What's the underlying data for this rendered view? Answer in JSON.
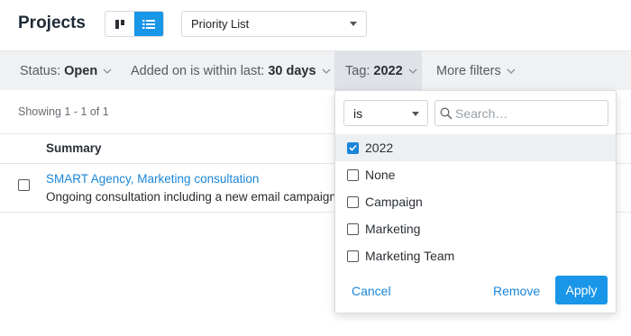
{
  "header": {
    "title": "Projects",
    "view_toggle": {
      "board_icon": "board-view-icon",
      "list_icon": "list-view-icon",
      "active": "list"
    },
    "list_select": {
      "value": "Priority List"
    }
  },
  "filters": [
    {
      "label": "Status:",
      "value": "Open"
    },
    {
      "label": "Added on is within last:",
      "value": "30 days"
    },
    {
      "label": "Tag:",
      "value": "2022"
    },
    {
      "label": "More filters",
      "value": ""
    }
  ],
  "results": {
    "showing": "Showing 1 - 1 of 1"
  },
  "table": {
    "columns": [
      "Summary"
    ],
    "rows": [
      {
        "title": "SMART Agency, Marketing consultation",
        "description": "Ongoing consultation including a new email campaign la"
      }
    ]
  },
  "tag_dropdown": {
    "operator": "is",
    "search_placeholder": "Search…",
    "options": [
      {
        "label": "2022",
        "checked": true
      },
      {
        "label": "None",
        "checked": false
      },
      {
        "label": "Campaign",
        "checked": false
      },
      {
        "label": "Marketing",
        "checked": false
      },
      {
        "label": "Marketing Team",
        "checked": false
      }
    ],
    "cancel_label": "Cancel",
    "remove_label": "Remove",
    "apply_label": "Apply"
  },
  "colors": {
    "accent": "#1a96e8",
    "link": "#1a86d8",
    "filterbar": "#eff1f3"
  }
}
